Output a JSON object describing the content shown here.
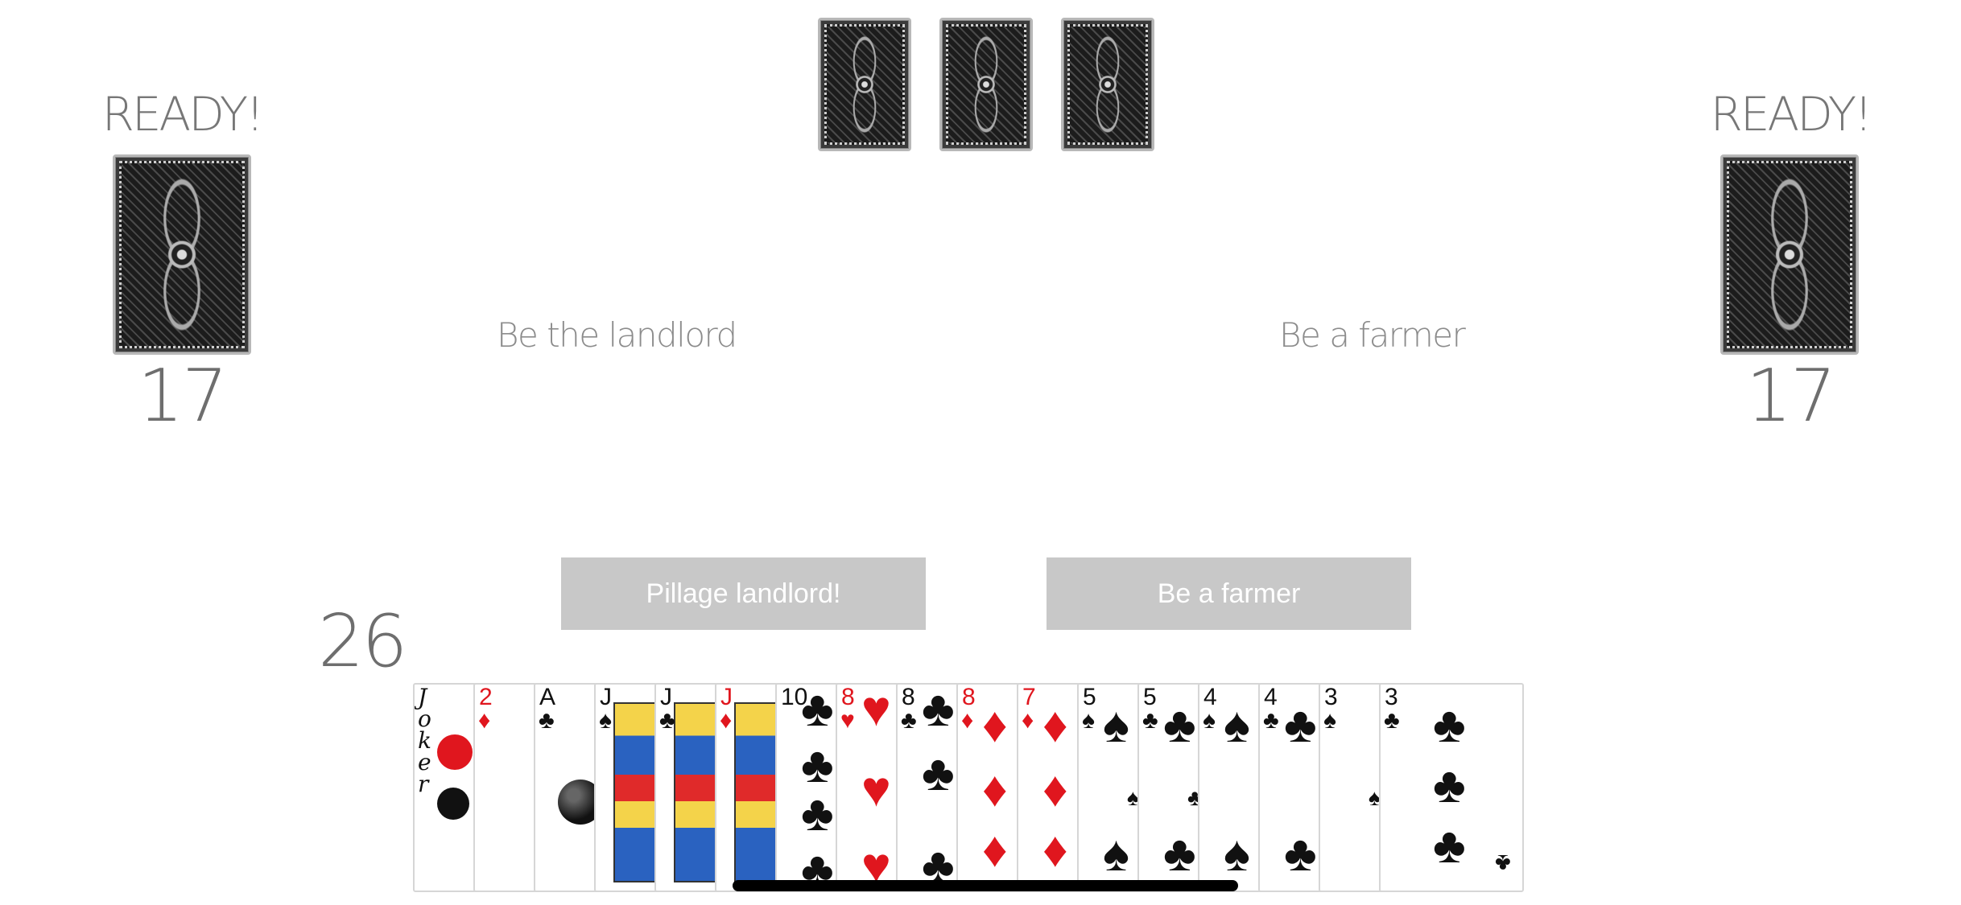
{
  "left_player": {
    "status": "READY!",
    "card_count": "17"
  },
  "right_player": {
    "status": "READY!",
    "card_count": "17"
  },
  "bonus_cards": {
    "count": 3
  },
  "prompts": {
    "landlord_text": "Be the landlord",
    "farmer_text": "Be a farmer"
  },
  "actions": {
    "pillage_label": "Pillage landlord!",
    "farmer_label": "Be a farmer"
  },
  "my_hand": {
    "card_count": "26",
    "cards": [
      {
        "rank": "Joker",
        "suit": "",
        "color": "black"
      },
      {
        "rank": "2",
        "suit": "♦",
        "color": "red"
      },
      {
        "rank": "A",
        "suit": "♣",
        "color": "black"
      },
      {
        "rank": "J",
        "suit": "♠",
        "color": "black"
      },
      {
        "rank": "J",
        "suit": "♣",
        "color": "black"
      },
      {
        "rank": "J",
        "suit": "♦",
        "color": "red"
      },
      {
        "rank": "10",
        "suit": "♣",
        "color": "black"
      },
      {
        "rank": "8",
        "suit": "♥",
        "color": "red"
      },
      {
        "rank": "8",
        "suit": "♣",
        "color": "black"
      },
      {
        "rank": "8",
        "suit": "♦",
        "color": "red"
      },
      {
        "rank": "7",
        "suit": "♦",
        "color": "red"
      },
      {
        "rank": "5",
        "suit": "♠",
        "color": "black"
      },
      {
        "rank": "5",
        "suit": "♣",
        "color": "black"
      },
      {
        "rank": "4",
        "suit": "♠",
        "color": "black"
      },
      {
        "rank": "4",
        "suit": "♣",
        "color": "black"
      },
      {
        "rank": "3",
        "suit": "♠",
        "color": "black"
      },
      {
        "rank": "3",
        "suit": "♣",
        "color": "black"
      }
    ]
  },
  "colors": {
    "button_bg": "#c8c8c8",
    "card_red": "#e0161e",
    "card_black": "#111111"
  }
}
